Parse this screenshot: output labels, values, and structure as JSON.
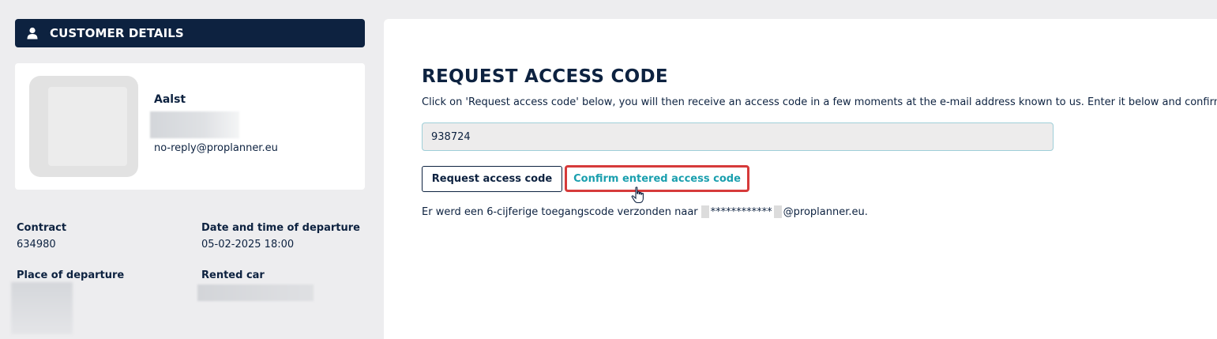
{
  "sidebar": {
    "header_title": "CUSTOMER DETAILS",
    "customer": {
      "name": "Aalst",
      "email": "no-reply@proplanner.eu"
    },
    "details": {
      "contract_label": "Contract",
      "contract_value": "634980",
      "departure_label": "Date and time of departure",
      "departure_value": "05-02-2025 18:00",
      "place_label": "Place of departure",
      "car_label": "Rented car"
    }
  },
  "main": {
    "title": "REQUEST ACCESS CODE",
    "instruction": "Click on 'Request access code' below, you will then receive an access code in a few moments at the e-mail address known to us. Enter it below and confirm.",
    "code_input_value": "938724",
    "request_button": "Request access code",
    "confirm_button": "Confirm entered access code",
    "sent_message_prefix": "Er werd een 6-cijferige toegangscode verzonden naar",
    "sent_message_masked": "************",
    "sent_message_suffix": "@proplanner.eu."
  },
  "colors": {
    "navy": "#0d2240",
    "teal": "#1a9fae",
    "highlight_red": "#d63a3a",
    "background": "#ededef"
  },
  "icons": {
    "header_icon": "user-icon",
    "cursor": "hand-pointer-icon"
  }
}
